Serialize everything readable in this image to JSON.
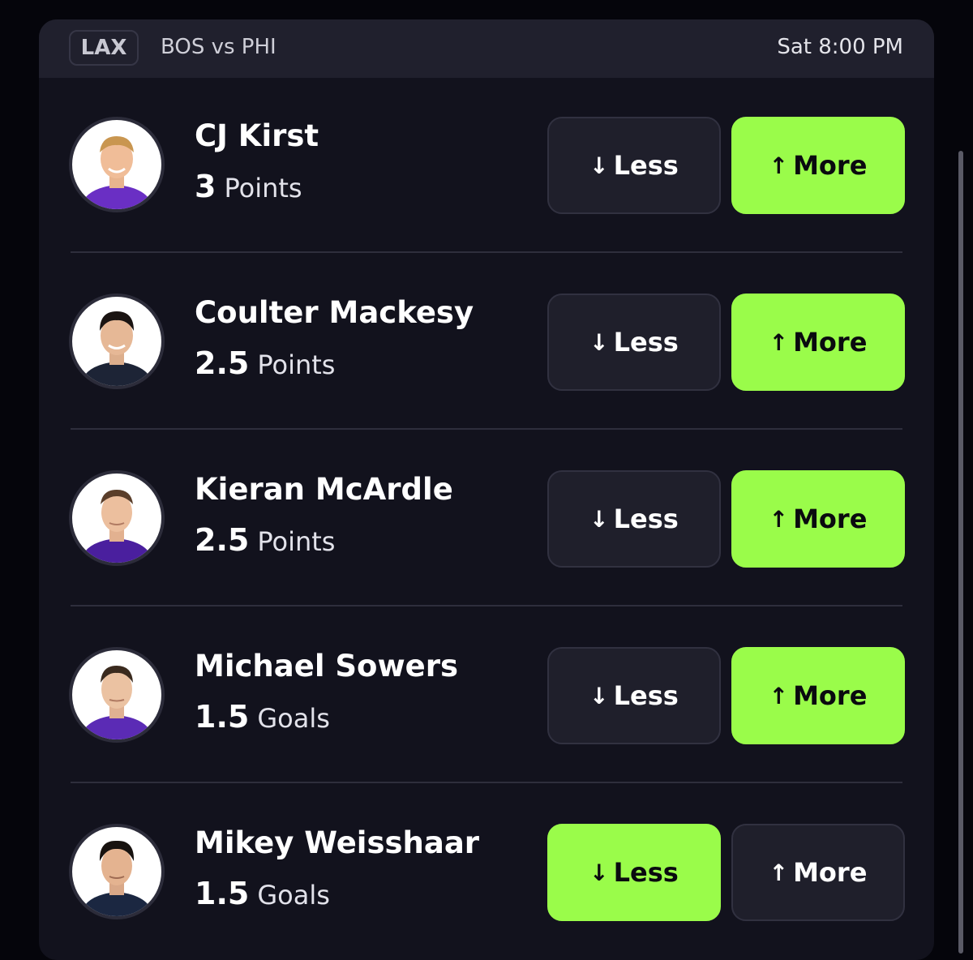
{
  "header": {
    "sport": "LAX",
    "matchup": "BOS vs PHI",
    "time": "Sat 8:00 PM"
  },
  "colors": {
    "accent": "#9afc4a",
    "card_bg": "#12121d",
    "header_bg": "#20202d",
    "button_bg": "#1f1f2b"
  },
  "buttons": {
    "less_label": "Less",
    "more_label": "More",
    "less_icon": "arrow-down-icon",
    "more_icon": "arrow-up-icon"
  },
  "players": [
    {
      "name": "CJ Kirst",
      "value": "3",
      "stat": "Points",
      "selected": "more"
    },
    {
      "name": "Coulter Mackesy",
      "value": "2.5",
      "stat": "Points",
      "selected": "more"
    },
    {
      "name": "Kieran McArdle",
      "value": "2.5",
      "stat": "Points",
      "selected": "more"
    },
    {
      "name": "Michael Sowers",
      "value": "1.5",
      "stat": "Goals",
      "selected": "more"
    },
    {
      "name": "Mikey Weisshaar",
      "value": "1.5",
      "stat": "Goals",
      "selected": "less"
    }
  ]
}
